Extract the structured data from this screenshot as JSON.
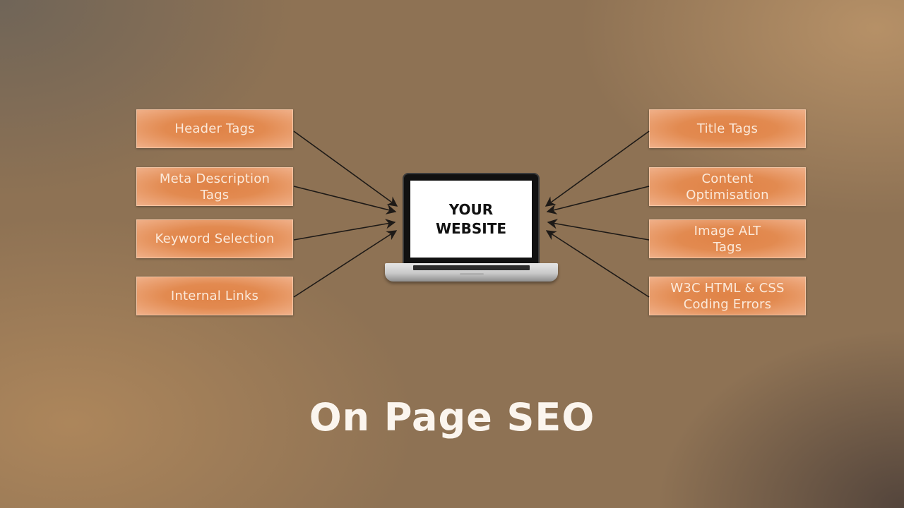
{
  "title": "On Page SEO",
  "center": {
    "line1": "YOUR",
    "line2": "WEBSITE",
    "icon": "laptop-icon"
  },
  "left_items": [
    {
      "label": "Header Tags"
    },
    {
      "label": "Meta Description\nTags"
    },
    {
      "label": "Keyword Selection"
    },
    {
      "label": "Internal Links"
    }
  ],
  "right_items": [
    {
      "label": "Title Tags"
    },
    {
      "label": "Content\nOptimisation"
    },
    {
      "label": "Image ALT\nTags"
    },
    {
      "label": "W3C HTML & CSS\nCoding Errors"
    }
  ],
  "colors": {
    "box_fill": "#e28a50",
    "box_text": "#fbe9da",
    "arrow": "#1e1a17",
    "title_text": "#fbf5ee"
  }
}
